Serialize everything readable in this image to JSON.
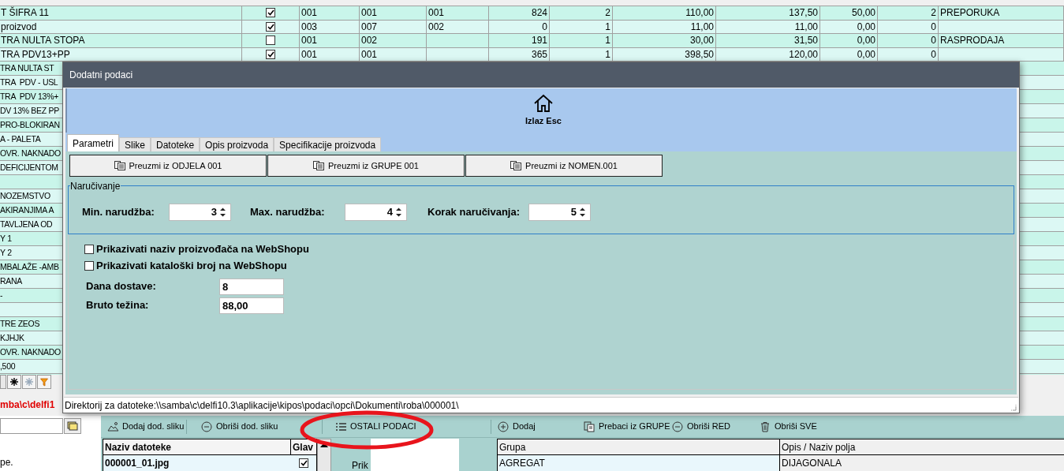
{
  "grid_rows": [
    {
      "name": "T ŠIFRA 11",
      "checked": true,
      "cells": {
        "column_3": "001",
        "column_4": "001",
        "column_5": "001",
        "column_6": "824",
        "column_7": "2",
        "column_8": "110,00",
        "column_9": "137,50",
        "column_10": "50,00",
        "column_11": "2",
        "column_12": "PREPORUKA"
      }
    },
    {
      "name": "proizvod",
      "checked": true,
      "cells": {
        "column_3": "003",
        "column_4": "007",
        "column_5": "002",
        "column_6": "0",
        "column_7": "1",
        "column_8": "11,00",
        "column_9": "11,00",
        "column_10": "0,00",
        "column_11": "0"
      }
    },
    {
      "name": "TRA NULTA STOPA",
      "checked": false,
      "cells": {
        "column_3": "001",
        "column_4": "002",
        "column_6": "191",
        "column_7": "1",
        "column_8": "30,00",
        "column_9": "31,50",
        "column_10": "0,00",
        "column_11": "0",
        "column_12": "RASPRODAJA"
      }
    },
    {
      "name": "TRA  PDV13+PP",
      "checked": true,
      "cells": {
        "column_3": "001",
        "column_4": "001",
        "column_6": "365",
        "column_7": "1",
        "column_8": "398,50",
        "column_9": "120,00",
        "column_10": "0,00",
        "column_11": "0"
      }
    }
  ],
  "covered_rows": [
    {
      "name": "TRA NULTA ST"
    },
    {
      "name": "TRA  PDV - USL"
    },
    {
      "name": "TRA  PDV 13%+"
    },
    {
      "name": "DV 13% BEZ PP"
    },
    {
      "name": "PRO-BLOKIRAN"
    },
    {
      "name": "A - PALETA"
    },
    {
      "name": "OVR. NAKNADO"
    },
    {
      "name": "DEFICIJENTOM"
    },
    {},
    {
      "name": "NOZEMSTVO"
    },
    {
      "name": "AKIRANJIMA A"
    },
    {
      "name": "TAVLJENA OD"
    },
    {
      "name": "Y 1"
    },
    {
      "name": "Y 2"
    },
    {
      "name": "MBALAŽE -AMB"
    },
    {
      "name": "RANA"
    },
    {
      "name": "-"
    },
    {},
    {
      "name": "TRE ZEOS"
    },
    {
      "name": "KJHJK"
    },
    {
      "name": "OVR. NAKNADO"
    },
    {
      "name": ",500"
    }
  ],
  "path_label": "mba\\c\\delfi1",
  "dialog": {
    "title": "Dodatni podaci",
    "exit_button": "Izlaz Esc",
    "tabs": [
      {
        "label": "Parametri",
        "selected": true
      },
      {
        "label": "Slike",
        "selected": false
      },
      {
        "label": "Datoteke",
        "selected": false
      },
      {
        "label": "Opis proizvoda",
        "selected": false
      },
      {
        "label": "Specifikacije proizvoda",
        "selected": false
      }
    ],
    "copy_buttons": [
      "Preuzmi iz ODJELA 001",
      "Preuzmi iz GRUPE 001",
      "Preuzmi iz NOMEN.001"
    ],
    "ordering": {
      "legend": "Naručivanje",
      "fields": [
        {
          "label": "Min. narudžba:",
          "value": "3"
        },
        {
          "label": "Max. narudžba:",
          "value": "4"
        },
        {
          "label": "Korak naručivanja:",
          "value": "5"
        }
      ]
    },
    "options": [
      {
        "label": "Prikazivati naziv proizvođača na WebShopu",
        "checked": false
      },
      {
        "label": "Prikazivati kataloški broj na WebShopu",
        "checked": false
      }
    ],
    "fields": [
      {
        "label": "Dana dostave:",
        "value": "8"
      },
      {
        "label": "Bruto težina:",
        "value": "88,00"
      }
    ],
    "status": "Direktorij za datoteke:\\\\samba\\c\\delfi10.3\\aplikacije\\kipos\\podaci\\opci\\Dokumenti\\roba\\000001\\"
  },
  "bottom": {
    "toolbar": [
      {
        "label": "Dodaj dod. sliku",
        "kind": "picture"
      },
      {
        "label": "Obriši dod. sliku",
        "kind": "remove"
      },
      {
        "label": "OSTALI PODACI",
        "kind": "list"
      },
      {
        "label": "Dodaj",
        "kind": "add"
      },
      {
        "label": "Prebaci iz GRUPE",
        "kind": "copy"
      },
      {
        "label": "Obriši RED",
        "kind": "remove"
      },
      {
        "label": "Obriši SVE",
        "kind": "trash"
      }
    ],
    "file_table": {
      "columns": [
        "Naziv datoteke",
        "Glav"
      ],
      "rows": [
        {
          "name": "000001_01.jpg",
          "checked": true
        }
      ]
    },
    "preview_label": "Prik",
    "group_table": {
      "columns": [
        "Grupa",
        "Opis / Naziv polja"
      ],
      "rows": [
        [
          "AGREGAT",
          "DIJAGONALA"
        ]
      ]
    },
    "side_note": "pe."
  }
}
